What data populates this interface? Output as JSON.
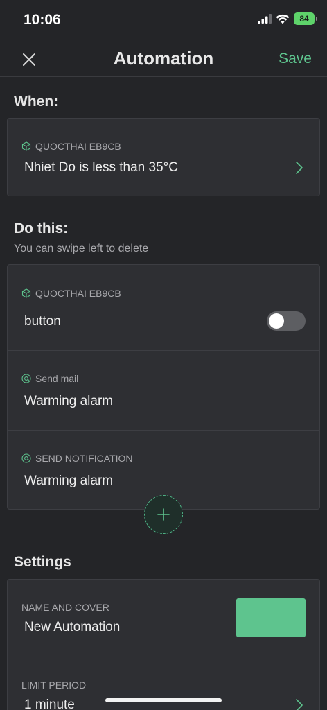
{
  "status_bar": {
    "time": "10:06",
    "battery": "84"
  },
  "nav": {
    "title": "Automation",
    "save_label": "Save"
  },
  "when": {
    "heading": "When:",
    "device": "QUOCTHAI EB9CB",
    "condition": "Nhiet Do is less than 35°C"
  },
  "do_this": {
    "heading": "Do this:",
    "hint": "You can swipe left to delete",
    "actions": [
      {
        "kind_label": "QUOCTHAI EB9CB",
        "value": "button",
        "icon": "cube-icon",
        "toggle_on": false
      },
      {
        "kind_label": "Send mail",
        "value": "Warming alarm",
        "icon": "at-icon"
      },
      {
        "kind_label": "SEND NOTIFICATION",
        "value": "Warming alarm",
        "icon": "at-icon"
      }
    ]
  },
  "settings": {
    "heading": "Settings",
    "name_and_cover_label": "NAME AND COVER",
    "name_value": "New Automation",
    "cover_color": "#5ec48e",
    "limit_period_label": "LIMIT PERIOD",
    "limit_period_value": "1 minute"
  },
  "colors": {
    "accent": "#5ec48e",
    "background": "#242528",
    "card": "#2e2f33"
  }
}
